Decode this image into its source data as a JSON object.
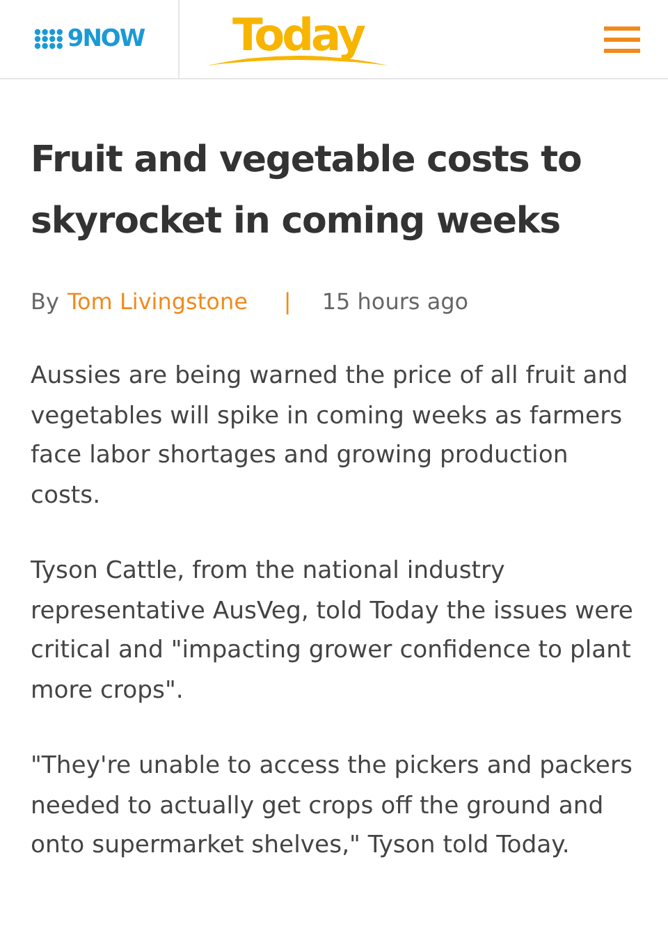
{
  "header": {
    "network_logo": "9NOW",
    "site_logo": "Today"
  },
  "article": {
    "title": "Fruit and vegetable costs to skyrocket in coming weeks",
    "byline": {
      "prefix": "By",
      "author": "Tom Livingstone",
      "separator": "|",
      "time": "15 hours ago"
    },
    "paragraphs": [
      "Aussies are being warned the price of all fruit and vegetables will spike in coming weeks as farmers face labor shortages and growing production costs.",
      "Tyson Cattle, from the national industry representative AusVeg, told Today the issues were critical and \"impacting grower confidence to plant more crops\".",
      "\"They're unable to access the pickers and packers needed to actually get crops off the ground and onto supermarket shelves,\" Tyson told Today."
    ]
  }
}
